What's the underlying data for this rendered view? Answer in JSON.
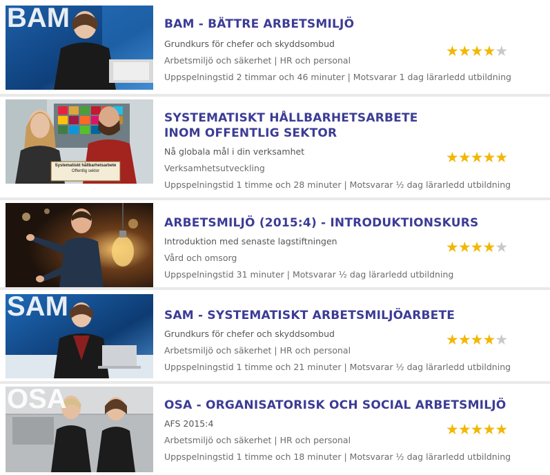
{
  "courses": [
    {
      "thumb_text": "BAM",
      "title": "BAM - BÄTTRE ARBETSMILJÖ",
      "subtitle": "Grundkurs för chefer och skyddsombud",
      "category": "Arbetsmiljö och säkerhet | HR och personal",
      "duration": "Uppspelningstid 2 timmar och 46 minuter | Motsvarar 1 dag lärarledd utbildning",
      "rating": 4,
      "rating_max": 5
    },
    {
      "thumb_text": "",
      "thumb_caption_1": "Systematiskt hållbarhetsarbete",
      "thumb_caption_2": "Offentlig sektor",
      "title": "SYSTEMATISKT HÅLLBARHETSARBETE INOM OFFENTLIG SEKTOR",
      "subtitle": "Nå globala mål i din verksamhet",
      "category": "Verksamhetsutveckling",
      "duration": "Uppspelningstid 1 timme och 28 minuter | Motsvarar ½ dag lärarledd utbildning",
      "rating": 5,
      "rating_max": 5
    },
    {
      "thumb_text": "",
      "title": "ARBETSMILJÖ (2015:4) - INTRODUKTIONSKURS",
      "subtitle": "Introduktion med senaste lagstiftningen",
      "category": "Vård och omsorg",
      "duration": "Uppspelningstid 31 minuter | Motsvarar ½ dag lärarledd utbildning",
      "rating": 4,
      "rating_max": 5
    },
    {
      "thumb_text": "SAM",
      "title": "SAM - SYSTEMATISKT ARBETSMILJÖARBETE",
      "subtitle": "Grundkurs för chefer och skyddsombud",
      "category": "Arbetsmiljö och säkerhet | HR och personal",
      "duration": "Uppspelningstid 1 timme och 21 minuter | Motsvarar ½ dag lärarledd utbildning",
      "rating": 4,
      "rating_max": 5
    },
    {
      "thumb_text": "OSA",
      "title": "OSA - ORGANISATORISK OCH SOCIAL ARBETSMILJÖ",
      "subtitle": "AFS 2015:4",
      "category": "Arbetsmiljö och säkerhet | HR och personal",
      "duration": "Uppspelningstid 1 timme och 18 minuter | Motsvarar ½ dag lärarledd utbildning",
      "rating": 5,
      "rating_max": 5
    }
  ],
  "colors": {
    "title": "#3c3c96",
    "star_on": "#f2b705",
    "star_off": "#c9c9c9",
    "separator": "#e9e9e9"
  }
}
